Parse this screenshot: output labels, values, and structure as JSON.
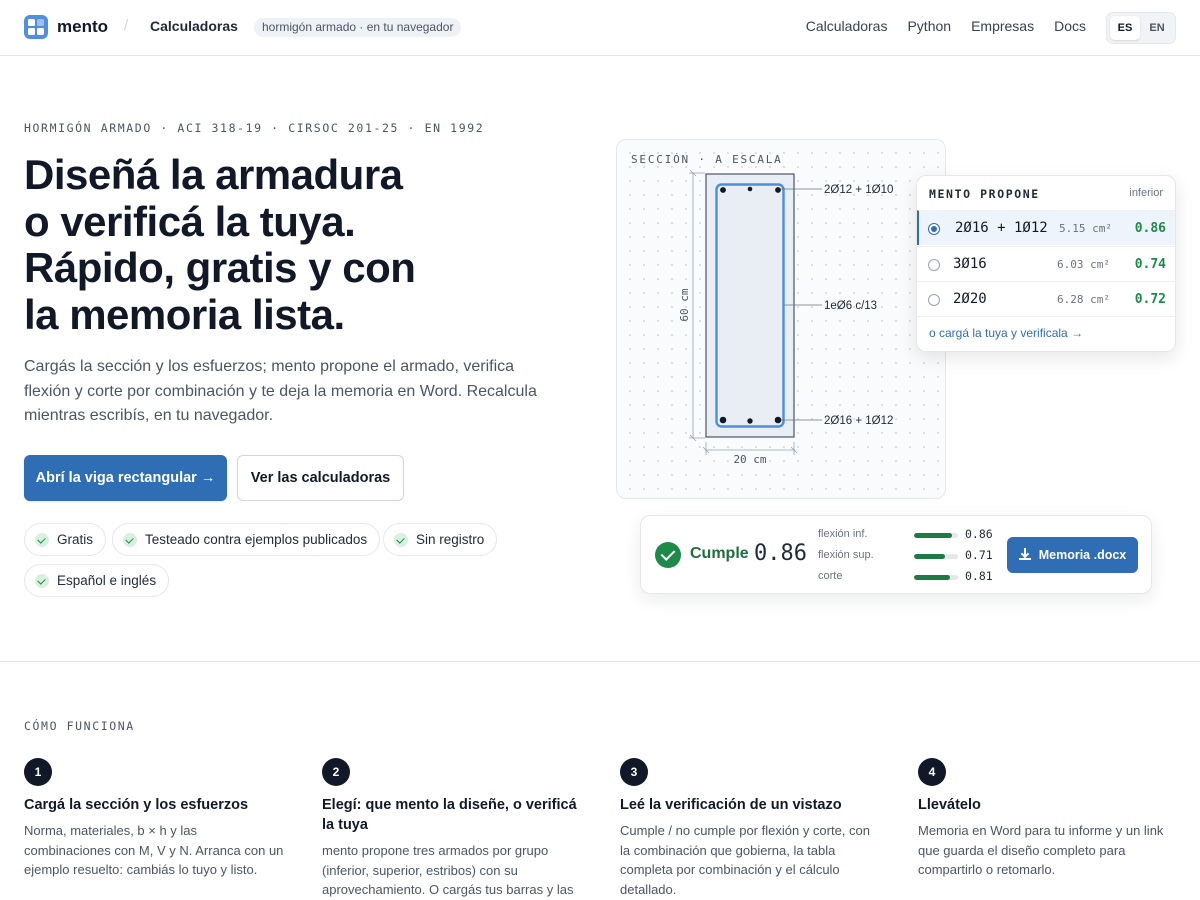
{
  "header": {
    "brand": "mento",
    "separator": "/",
    "crumb": "Calculadoras",
    "tag": "hormigón armado · en tu navegador",
    "nav": [
      "Calculadoras",
      "Python",
      "Empresas",
      "Docs"
    ],
    "lang": [
      "ES",
      "EN"
    ],
    "lang_active": "ES"
  },
  "hero": {
    "eyebrow": "HORMIGÓN ARMADO · ACI 318-19 · CIRSOC 201-25 · EN 1992",
    "headline": [
      "Diseñá la armadura",
      "o verificá la tuya.",
      "Rápido, gratis y con",
      "la memoria lista."
    ],
    "lede": "Cargás la sección y los esfuerzos; mento propone el armado, verifica flexión y corte por combinación y te deja la memoria en Word. Recalcula mientras escribís, en tu navegador.",
    "primary_cta": "Abrí la viga rectangular →",
    "secondary_cta": "Ver las calculadoras",
    "chips": [
      "Gratis",
      "Testeado contra ejemplos publicados",
      "Sin registro",
      "Español e inglés"
    ]
  },
  "section_drawing": {
    "title": "SECCIÓN · A ESCALA",
    "top_bars": "2Ø12 + 1Ø10",
    "stirrups": "1eØ6 c/13",
    "bottom_bars": "2Ø16 + 1Ø12",
    "height": "60 cm",
    "width": "20 cm",
    "colors": {
      "stirrup": "#4a90d9",
      "concrete": "#e9eef5",
      "outline": "#475569"
    }
  },
  "proposal": {
    "title": "MENTO PROPONE",
    "group": "inferior",
    "options": [
      {
        "bars": "2Ø16 + 1Ø12",
        "area": "5.15 cm²",
        "ratio": "0.86",
        "selected": true
      },
      {
        "bars": "3Ø16",
        "area": "6.03 cm²",
        "ratio": "0.74",
        "selected": false
      },
      {
        "bars": "2Ø20",
        "area": "6.28 cm²",
        "ratio": "0.72",
        "selected": false
      }
    ],
    "link": "o cargá la tuya y verificala →"
  },
  "result": {
    "status": "Cumple",
    "value": "0.86",
    "checks": [
      {
        "name": "flexión inf.",
        "value": "0.86",
        "fraction": 0.86
      },
      {
        "name": "flexión sup.",
        "value": "0.71",
        "fraction": 0.71
      },
      {
        "name": "corte",
        "value": "0.81",
        "fraction": 0.81
      }
    ],
    "button": "Memoria .docx",
    "colors": {
      "ok": "#1e8a47",
      "accent": "#2f6db5"
    }
  },
  "how": {
    "title": "CÓMO FUNCIONA",
    "steps": [
      {
        "num": "1",
        "title": "Cargá la sección y los esfuerzos",
        "body": "Norma, materiales, b × h y las combinaciones con M, V y N. Arranca con un ejemplo resuelto: cambiás lo tuyo y listo."
      },
      {
        "num": "2",
        "title": "Elegí: que mento la diseñe, o verificá la tuya",
        "body": "mento propone tres armados por grupo (inferior, superior, estribos) con su aprovechamiento. O cargás tus barras y las"
      },
      {
        "num": "3",
        "title": "Leé la verificación de un vistazo",
        "body": "Cumple / no cumple por flexión y corte, con la combinación que gobierna, la tabla completa por combinación y el cálculo detallado."
      },
      {
        "num": "4",
        "title": "Llevátelo",
        "body": "Memoria en Word para tu informe y un link que guarda el diseño completo para compartirlo o retomarlo."
      }
    ]
  }
}
